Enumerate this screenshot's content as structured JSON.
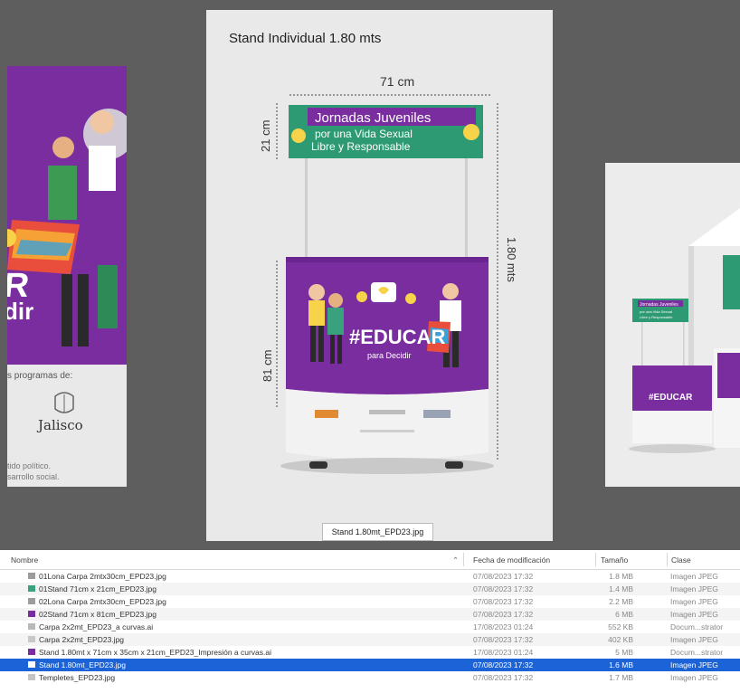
{
  "gallery": {
    "title": "Stand Individual 1.80 mts",
    "caption": "Stand 1.80mt_EPD23.jpg",
    "dims": {
      "width": "71 cm",
      "header": "21 cm",
      "total": "1.80 mts",
      "body": "81 cm"
    },
    "banner": {
      "line1": "Jornadas Juveniles",
      "line2": "por una Vida Sexual",
      "line3": "Libre y Responsable"
    },
    "counter": {
      "hashtag": "#EDUCAR",
      "sub": "para Decidir"
    },
    "left_preview": {
      "big": "AR",
      "sub": "dir",
      "programs": "s programas de:",
      "jalisco": "Jalisco",
      "footer1": "tido político.",
      "footer2": "sarrollo social."
    },
    "right_preview": {
      "banner1": "Jornadas Juveniles",
      "banner2": "por una Vida Sexual",
      "banner3": "Libre y Responsable",
      "hashtag": "#EDUCAR"
    }
  },
  "file_list": {
    "columns": {
      "name": "Nombre",
      "date": "Fecha de modificación",
      "size": "Tamaño",
      "kind": "Clase"
    },
    "rows": [
      {
        "name": "01Lona Carpa 2mtx30cm_EPD23.jpg",
        "date": "07/08/2023 17:32",
        "size": "1.8 MB",
        "kind": "Imagen JPEG",
        "icon": "image-file-icon",
        "icon_color": "#9c9c9c"
      },
      {
        "name": "01Stand 71cm x 21cm_EPD23.jpg",
        "date": "07/08/2023 17:32",
        "size": "1.4 MB",
        "kind": "Imagen JPEG",
        "icon": "image-file-icon",
        "icon_color": "#3aa17e"
      },
      {
        "name": "02Lona Carpa 2mtx30cm_EPD23.jpg",
        "date": "07/08/2023 17:32",
        "size": "2.2 MB",
        "kind": "Imagen JPEG",
        "icon": "image-file-icon",
        "icon_color": "#9c9c9c"
      },
      {
        "name": "02Stand 71cm x 81cm_EPD23.jpg",
        "date": "07/08/2023 17:32",
        "size": "6 MB",
        "kind": "Imagen JPEG",
        "icon": "image-file-icon",
        "icon_color": "#7a2d9f"
      },
      {
        "name": "Carpa 2x2mt_EPD23_a curvas.ai",
        "date": "17/08/2023 01:24",
        "size": "552 KB",
        "kind": "Docum...strator",
        "icon": "illustrator-file-icon",
        "icon_color": "#b9b9b9"
      },
      {
        "name": "Carpa 2x2mt_EPD23.jpg",
        "date": "07/08/2023 17:32",
        "size": "402 KB",
        "kind": "Imagen JPEG",
        "icon": "image-file-icon",
        "icon_color": "#c8c8c8"
      },
      {
        "name": "Stand 1.80mt x 71cm x 35cm x 21cm_EPD23_Impresión a curvas.ai",
        "date": "17/08/2023 01:24",
        "size": "5 MB",
        "kind": "Docum...strator",
        "icon": "illustrator-file-icon",
        "icon_color": "#7a2d9f"
      },
      {
        "name": "Stand 1.80mt_EPD23.jpg",
        "date": "07/08/2023 17:32",
        "size": "1.6 MB",
        "kind": "Imagen JPEG",
        "icon": "image-file-icon",
        "icon_color": "#ffffff"
      },
      {
        "name": "Templetes_EPD23.jpg",
        "date": "07/08/2023 17:32",
        "size": "1.7 MB",
        "kind": "Imagen JPEG",
        "icon": "image-file-icon",
        "icon_color": "#c4c4c4"
      }
    ]
  }
}
